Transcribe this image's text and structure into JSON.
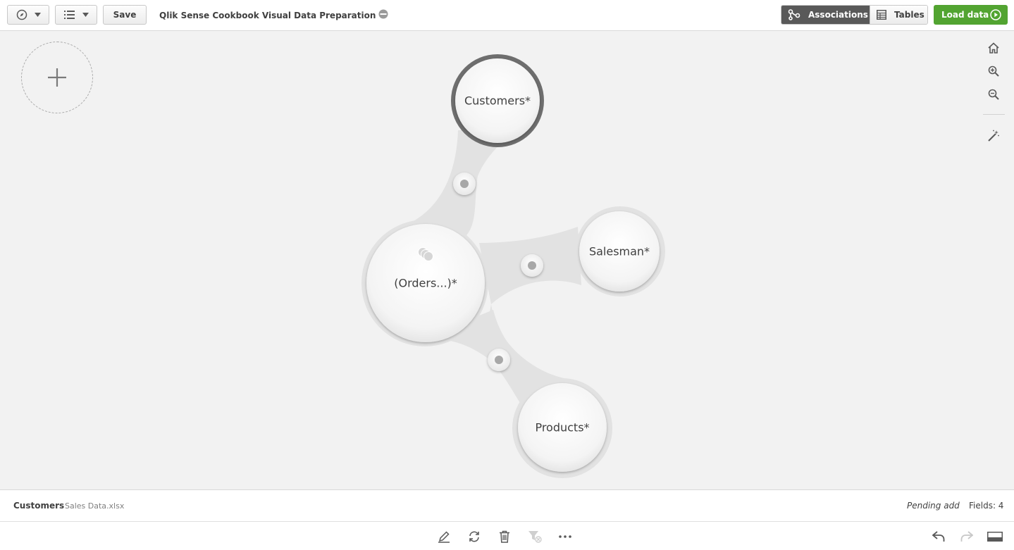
{
  "toolbar": {
    "nav_icon": "compass-icon",
    "menu_icon": "list-icon",
    "save_label": "Save",
    "app_title": "Qlik Sense Cookbook Visual Data Preparation",
    "published_icon": "published-icon",
    "view_tabs": [
      {
        "label": "Associations",
        "icon": "associations-icon",
        "active": true
      },
      {
        "label": "Tables",
        "icon": "table-icon",
        "active": false
      }
    ],
    "load_data_label": "Load data",
    "load_data_icon": "play-icon",
    "load_data_color": "#52a431"
  },
  "canvas": {
    "add_table_icon": "plus-icon",
    "tools": [
      "home-icon",
      "zoom-in-icon",
      "zoom-out-icon",
      "magic-wand-icon"
    ],
    "nodes": [
      {
        "label": "Customers*",
        "selected": true
      },
      {
        "label": "(Orders...)*",
        "icon": "linked-tables-icon"
      },
      {
        "label": "Salesman*"
      },
      {
        "label": "Products*"
      }
    ],
    "link_count": 3
  },
  "infobar": {
    "table_name": "Customers",
    "source": "Sales Data.xlsx",
    "status": "Pending add",
    "fields": "Fields: 4"
  },
  "bottombar": {
    "actions": [
      "edit-icon",
      "refresh-icon",
      "delete-icon",
      "filter-icon",
      "more-icon"
    ],
    "right_actions": [
      "undo-icon",
      "redo-icon",
      "panel-toggle-icon"
    ]
  }
}
